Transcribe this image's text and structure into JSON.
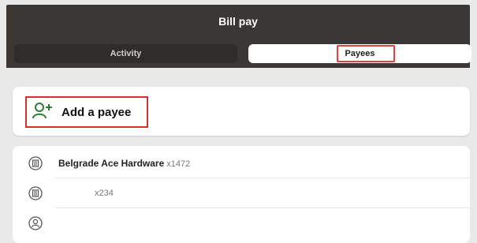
{
  "header": {
    "title": "Bill pay"
  },
  "tabs": [
    {
      "label": "Activity",
      "selected": false
    },
    {
      "label": "Payees",
      "selected": true
    }
  ],
  "add_payee": {
    "label": "Add a payee",
    "icon": "add-person-icon"
  },
  "payees": [
    {
      "name": "Belgrade Ace Hardware",
      "account": "x1472",
      "icon": "building-icon"
    },
    {
      "name": "",
      "account": "x234",
      "icon": "building-icon"
    },
    {
      "name": "",
      "account": "",
      "icon": "person-icon"
    }
  ],
  "colors": {
    "header_bg": "#3a3735",
    "accent_green": "#2e7d32",
    "highlight_red": "#d8302c"
  }
}
